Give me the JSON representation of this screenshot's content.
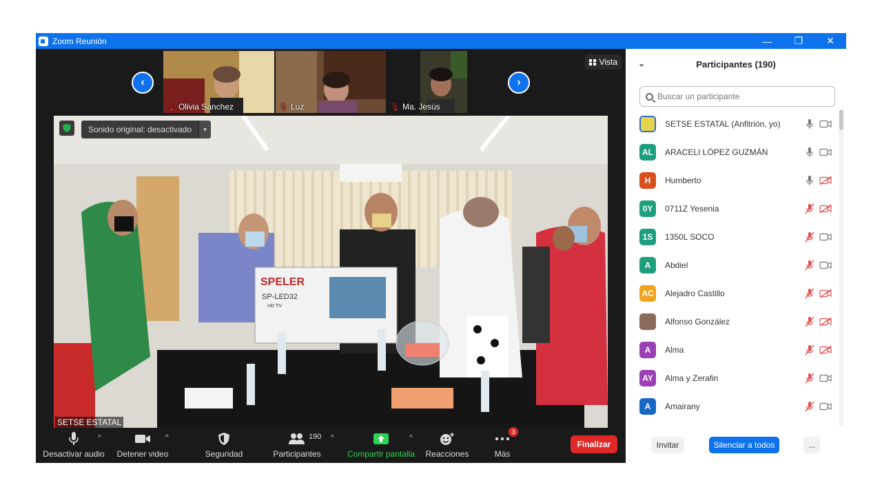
{
  "window": {
    "title": "Zoom Reunión",
    "minimize": "—",
    "restore": "❐",
    "close": "✕"
  },
  "strip": {
    "prev": "‹",
    "next": "›",
    "view_label": "Vista",
    "thumbnails": [
      {
        "name": "Olivia Sanchez"
      },
      {
        "name": "Luz"
      },
      {
        "name": "Ma. Jesús"
      }
    ]
  },
  "main_video": {
    "speaker": "SETSE ESTATAL",
    "sound_label": "Sonido original: desactivado",
    "box_brand": "SPELER",
    "box_model": "SP-LED32",
    "box_sub": "HD TV"
  },
  "toolbar": {
    "mute": "Desactivar audio",
    "video": "Detener video",
    "security": "Seguridad",
    "participants": "Participantes",
    "participants_count": "190",
    "share": "Compartir pantalla",
    "reactions": "Reacciones",
    "more": "Más",
    "more_badge": "3",
    "end": "Finalizar"
  },
  "panel": {
    "title": "Participantes (190)",
    "search_placeholder": "Buscar un participante",
    "invite": "Invitar",
    "mute_all": "Silenciar a todos",
    "more": "...",
    "participants": [
      {
        "initials": "",
        "name": "SETSE ESTATAL (Anfitrión, yo)",
        "color": "#e8d44a",
        "mic": "on",
        "cam": "on"
      },
      {
        "initials": "AL",
        "name": "ARACELI LÓPEZ GUZMÁN",
        "color": "#1d9e7d",
        "mic": "on",
        "cam": "on"
      },
      {
        "initials": "H",
        "name": "Humberto",
        "color": "#d8501b",
        "mic": "on",
        "cam": "off"
      },
      {
        "initials": "0Y",
        "name": "0711Z Yesenia",
        "color": "#1d9e7d",
        "mic": "off",
        "cam": "off"
      },
      {
        "initials": "1S",
        "name": "1350L SOCO",
        "color": "#1d9e7d",
        "mic": "off",
        "cam": "on"
      },
      {
        "initials": "A",
        "name": "Abdiel",
        "color": "#1d9e7d",
        "mic": "off",
        "cam": "on"
      },
      {
        "initials": "AC",
        "name": "Alejadro Castillo",
        "color": "#f0a31e",
        "mic": "off",
        "cam": "off"
      },
      {
        "initials": "",
        "name": "Alfonso González",
        "color": "#8a6a5a",
        "mic": "off",
        "cam": "off"
      },
      {
        "initials": "A",
        "name": "Alma",
        "color": "#9b3fb5",
        "mic": "off",
        "cam": "off"
      },
      {
        "initials": "AY",
        "name": "Alma y Zerafin",
        "color": "#9b3fb5",
        "mic": "off",
        "cam": "on"
      },
      {
        "initials": "A",
        "name": "Amairany",
        "color": "#1868c4",
        "mic": "off",
        "cam": "on"
      }
    ]
  }
}
